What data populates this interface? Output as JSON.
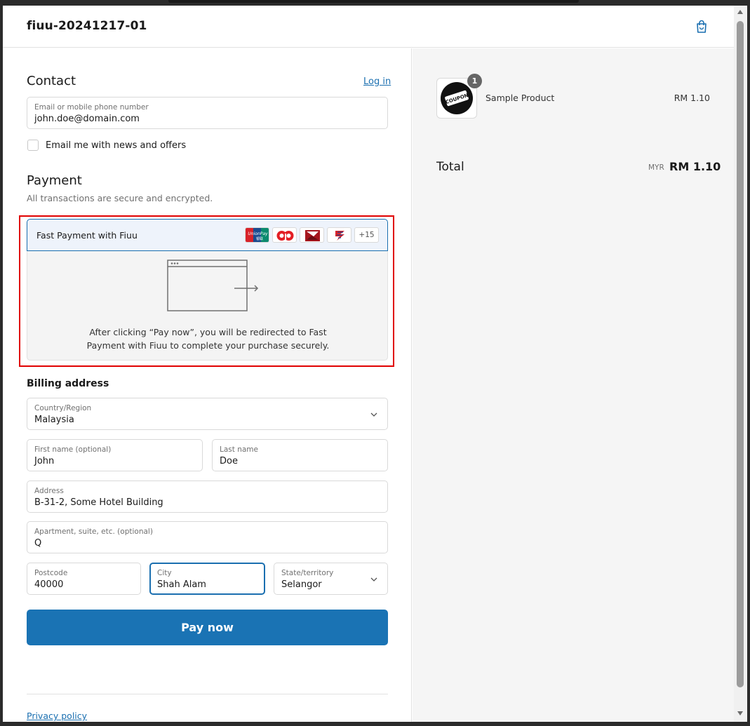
{
  "header": {
    "title": "fiuu-20241217-01",
    "cart_icon": "shopping-bag-icon"
  },
  "contact": {
    "title": "Contact",
    "login_label": "Log in",
    "email": {
      "label": "Email or mobile phone number",
      "value": "john.doe@domain.com"
    },
    "newsletter_label": "Email me with news and offers",
    "newsletter_checked": false
  },
  "payment": {
    "title": "Payment",
    "subtitle": "All transactions are secure and encrypted.",
    "method_name": "Fast Payment with Fiuu",
    "badges": [
      "unionpay-logo",
      "ambank-logo",
      "affin-logo",
      "bank-logo"
    ],
    "more_label": "+15",
    "redirect_message": "After clicking “Pay now”, you will be redirected to Fast Payment with Fiuu to complete your purchase securely.",
    "highlight_color": "#e00000"
  },
  "billing": {
    "title": "Billing address",
    "country": {
      "label": "Country/Region",
      "value": "Malaysia"
    },
    "first_name": {
      "label": "First name (optional)",
      "value": "John"
    },
    "last_name": {
      "label": "Last name",
      "value": "Doe"
    },
    "address": {
      "label": "Address",
      "value": "B-31-2, Some Hotel Building"
    },
    "apartment": {
      "label": "Apartment, suite, etc. (optional)",
      "value": "Q"
    },
    "postcode": {
      "label": "Postcode",
      "value": "40000"
    },
    "city": {
      "label": "City",
      "value": "Shah Alam"
    },
    "state": {
      "label": "State/territory",
      "value": "Selangor"
    }
  },
  "pay_button_label": "Pay now",
  "privacy_label": "Privacy policy",
  "summary": {
    "items": [
      {
        "name": "Sample Product",
        "price": "RM 1.10",
        "quantity": "1",
        "thumbnail_text": "COUPON"
      }
    ],
    "total_label": "Total",
    "currency": "MYR",
    "total_value": "RM 1.10"
  },
  "colors": {
    "accent": "#1a73b4",
    "link": "#1a6fb0",
    "summary_bg": "#f5f5f5"
  }
}
